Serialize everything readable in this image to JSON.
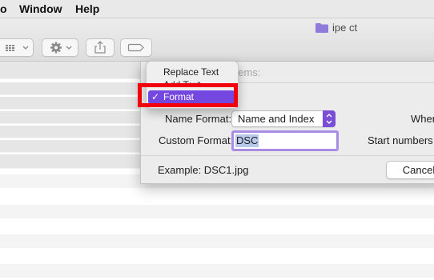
{
  "menubar": {
    "item_partial": "o",
    "window": "Window",
    "help": "Help"
  },
  "window": {
    "title": "ipe ct",
    "folder_color": "#8f7bd9"
  },
  "sheet": {
    "header_partial": "Items:",
    "replace_text": "Replace Text",
    "add_text": "Add Text",
    "format": "Format",
    "checkmark": "✓",
    "name_format_label": "Name Format:",
    "name_format_value": "Name and Index",
    "where_partial": "Where",
    "custom_format_label": "Custom Format:",
    "custom_format_value": "DSC",
    "start_numbers_partial": "Start numbers a",
    "example": "Example: DSC1.jpg",
    "cancel": "Cancel"
  },
  "colors": {
    "accent": "#7448e0",
    "annotation": "#f2000b",
    "focus_ring": "#a98ce6"
  }
}
